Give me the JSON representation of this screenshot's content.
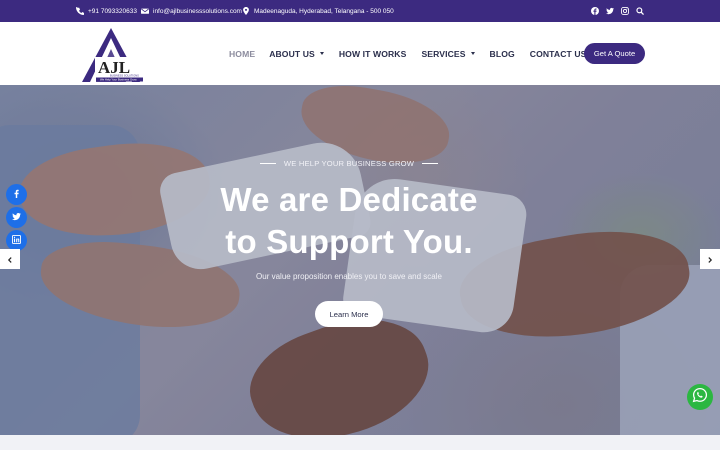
{
  "topbar": {
    "phone": "+91 7093320633",
    "email": "info@ajlbusinesssolutions.com",
    "address": "Madeenaguda, Hyderabad, Telangana - 500 050",
    "icons": [
      "phone-icon",
      "mail-icon",
      "map-pin-icon"
    ],
    "social": [
      "facebook-icon",
      "twitter-icon",
      "instagram-icon",
      "search-icon"
    ],
    "bg_color": "#3c2a80"
  },
  "logo": {
    "letters": "AJL",
    "line1": "BUSINESS SOLUTIONS",
    "line2": "We Help Your Business Grow"
  },
  "nav": {
    "items": [
      {
        "label": "HOME",
        "active": true,
        "dropdown": false
      },
      {
        "label": "ABOUT US",
        "active": false,
        "dropdown": true
      },
      {
        "label": "HOW IT WORKS",
        "active": false,
        "dropdown": false
      },
      {
        "label": "SERVICES",
        "active": false,
        "dropdown": true
      },
      {
        "label": "BLOG",
        "active": false,
        "dropdown": false
      },
      {
        "label": "CONTACT US",
        "active": false,
        "dropdown": false
      }
    ],
    "cta": "Get A Quote"
  },
  "hero": {
    "kicker": "WE HELP YOUR BUSINESS GROW",
    "headline_line1": "We are Dedicate",
    "headline_line2": "to Support You.",
    "subtext": "Our value proposition enables you to save and scale",
    "button": "Learn More"
  },
  "share": [
    "facebook-icon",
    "twitter-icon",
    "linkedin-icon"
  ],
  "slider": {
    "prev": "chevron-left-icon",
    "next": "chevron-right-icon"
  },
  "colors": {
    "brand": "#3c2a80",
    "nav_text": "#2b2f4c",
    "share_blue": "#1e6fe8",
    "whatsapp": "#2bb741"
  }
}
